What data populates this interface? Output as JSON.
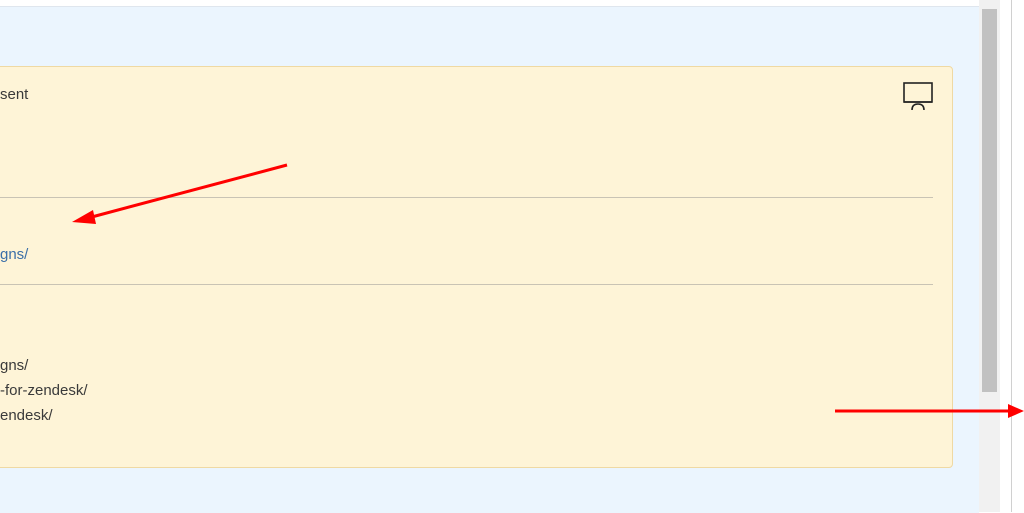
{
  "card": {
    "header_text": "sent",
    "link_text": "gns/",
    "list_items": [
      "gns/",
      "-for-zendesk/",
      "endesk/"
    ]
  },
  "icons": {
    "present": "presentation-screen-icon"
  },
  "colors": {
    "page_background": "#ebf5fe",
    "card_background": "#fef4d7",
    "card_border": "#efd9a3",
    "link": "#3b6fa8",
    "annotation_arrow": "#ff0000"
  }
}
